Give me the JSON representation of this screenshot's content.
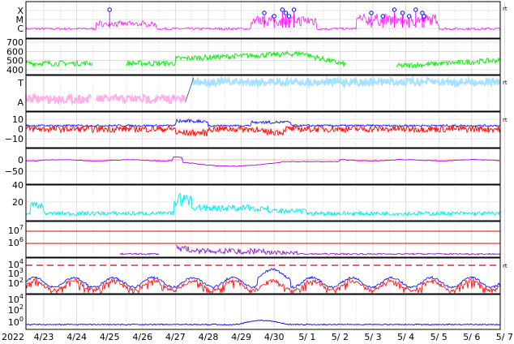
{
  "chart_data": {
    "type": "line",
    "year_label": "2022",
    "x_ticks": [
      "4/23",
      "4/24",
      "4/25",
      "4/26",
      "4/27",
      "4/28",
      "4/29",
      "4/30",
      "5/ 1",
      "5/ 2",
      "5/ 3",
      "5/ 4",
      "5/ 5",
      "5/ 6",
      "5/ 7"
    ],
    "grid": true,
    "panels": [
      {
        "id": "xray",
        "y_tick_labels": [
          "X",
          "M",
          "C"
        ],
        "corner_mark": "rt",
        "series_color": "#ff00ff",
        "flare_markers_day": [
          2.0,
          6.7,
          7.0,
          7.25,
          7.35,
          7.45,
          7.6,
          9.95,
          10.3,
          10.65,
          10.9,
          11.1,
          11.3,
          11.5,
          11.55
        ]
      },
      {
        "id": "solar-wind-speed",
        "y_ticks": [
          400,
          500,
          600,
          700
        ],
        "series_color": "#00ee00"
      },
      {
        "id": "polarity",
        "y_tick_labels": [
          "T",
          "A"
        ],
        "corner_mark": "rt",
        "series_colors": [
          "#a8e0ff",
          "#ffb0e8"
        ]
      },
      {
        "id": "imf",
        "y_ticks": [
          10,
          0,
          -10
        ],
        "corner_mark": "rt",
        "series_colors": [
          "#0000ff",
          "#ff0000"
        ]
      },
      {
        "id": "dst",
        "y_ticks": [
          0,
          -50
        ],
        "series_color": "#aa00ff"
      },
      {
        "id": "density",
        "y_ticks": [
          40,
          20
        ],
        "series_color": "#00e8e8"
      },
      {
        "id": "electron-flux",
        "y_ticks": [
          "10^7",
          "10^6"
        ],
        "series_color": "#8800cc",
        "threshold_lines": [
          "10^7",
          "10^6"
        ]
      },
      {
        "id": "proton-flux",
        "y_ticks": [
          "10^4",
          "10^3",
          "10^2"
        ],
        "corner_mark": "rt",
        "series_colors": [
          "#0000ff",
          "#ff0000"
        ]
      },
      {
        "id": "high-energy-proton",
        "y_ticks": [
          "10^4",
          "10^2",
          "10^0"
        ],
        "series_color": "#0000ff"
      }
    ]
  }
}
